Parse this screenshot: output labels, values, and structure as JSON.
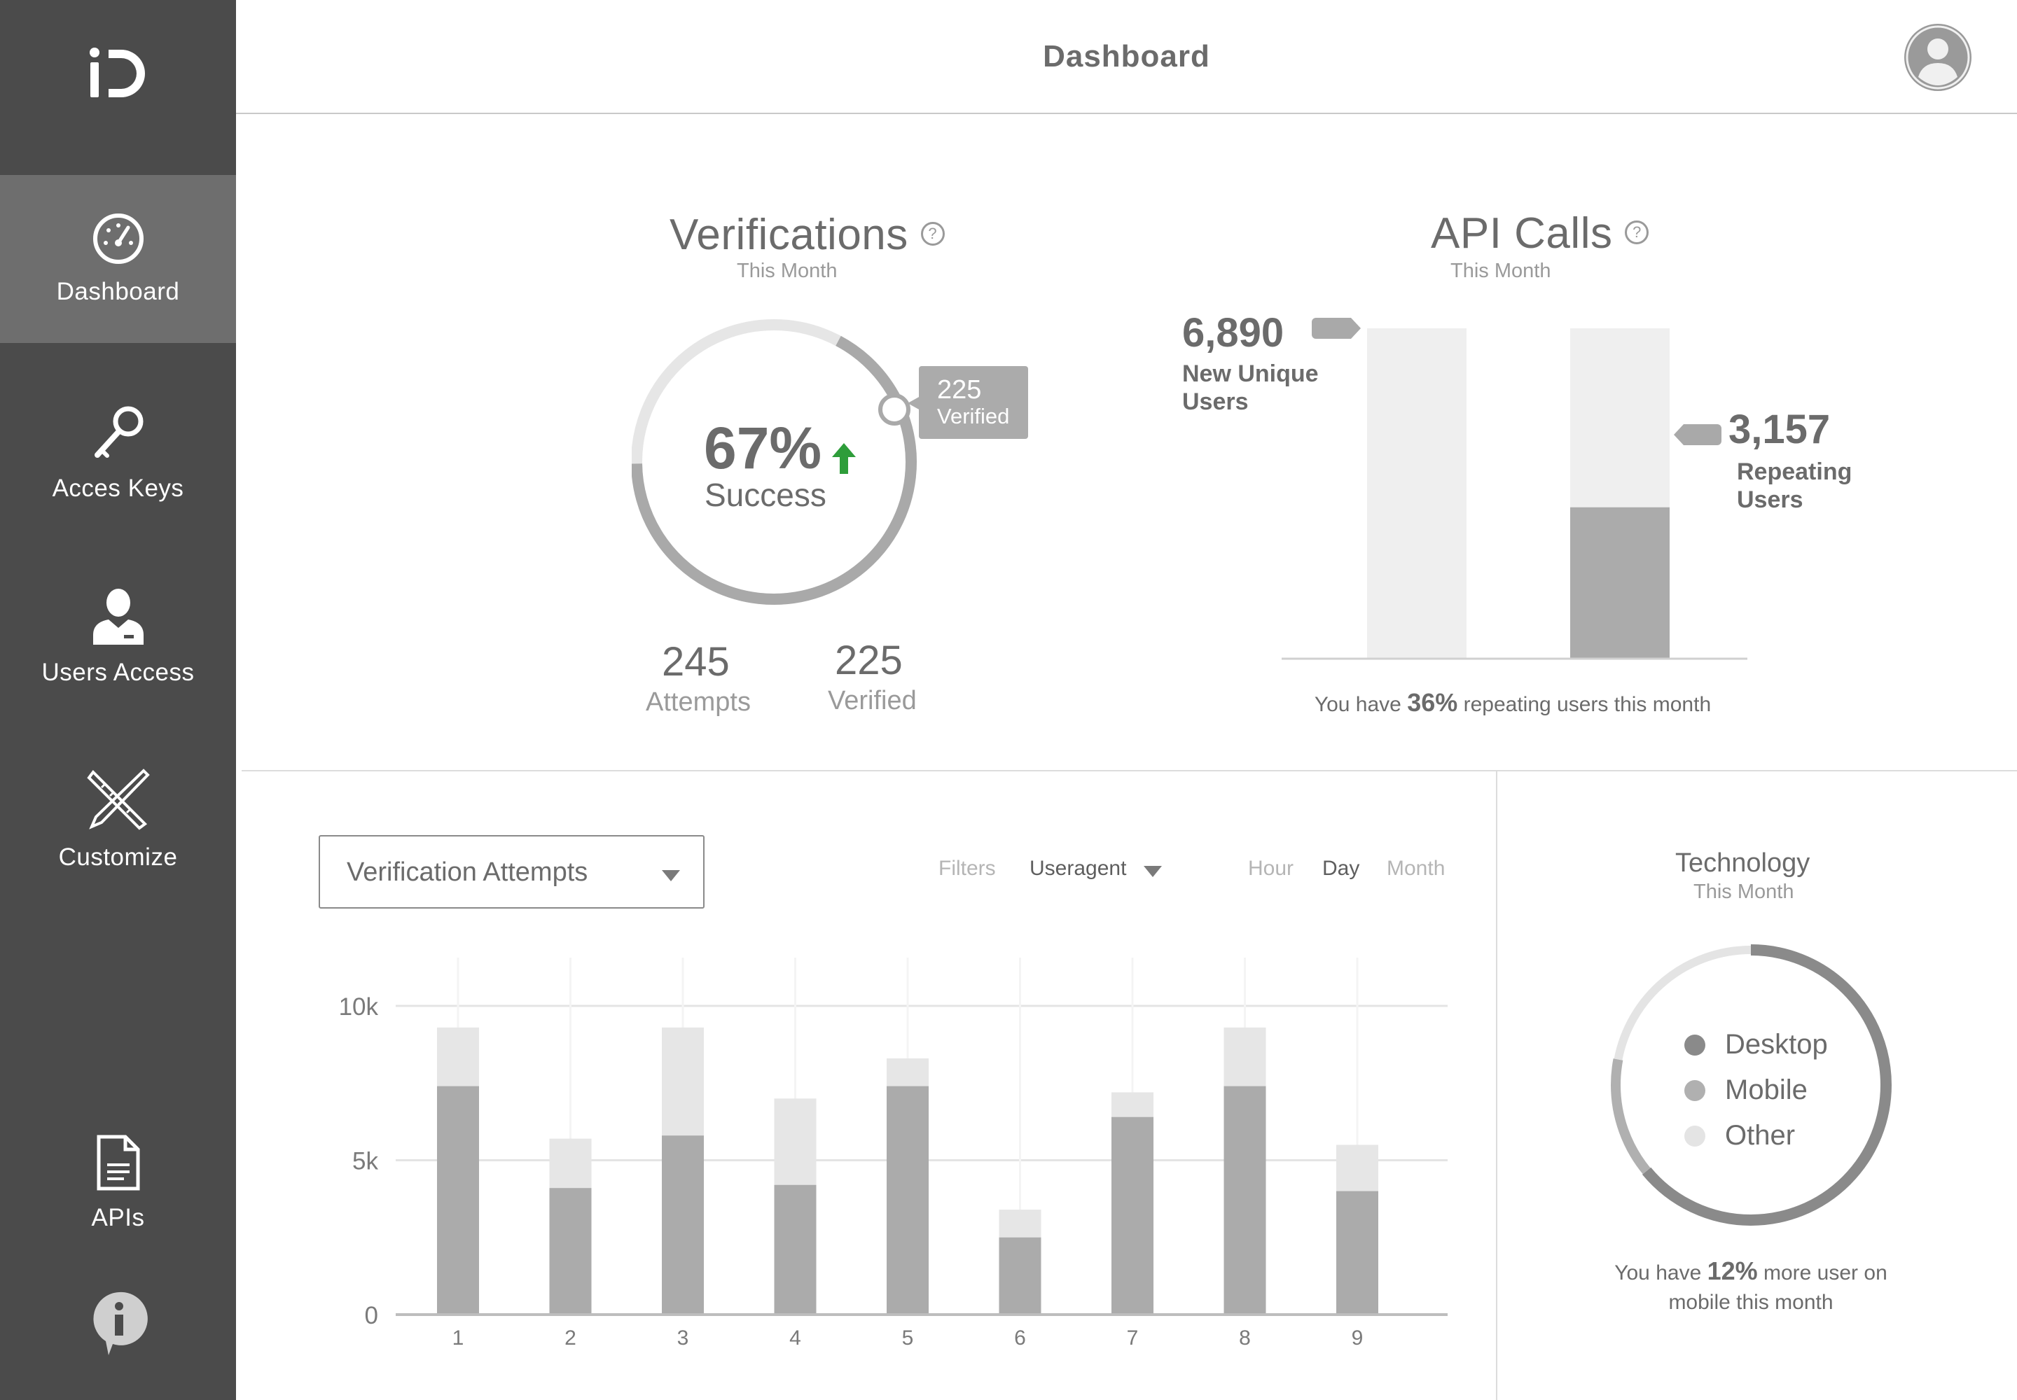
{
  "app": {
    "logo_text": "iD"
  },
  "header": {
    "title": "Dashboard"
  },
  "sidebar": {
    "items": [
      {
        "label": "Dashboard",
        "icon": "gauge-icon",
        "active": true
      },
      {
        "label": "Acces Keys",
        "icon": "key-icon"
      },
      {
        "label": "Users Access",
        "icon": "user-icon"
      },
      {
        "label": "Customize",
        "icon": "tools-icon"
      },
      {
        "label": "APIs",
        "icon": "document-icon"
      }
    ],
    "info_icon": "info-icon"
  },
  "verifications": {
    "title": "Verifications",
    "subtitle": "This Month",
    "help": "?",
    "percent_label": "67%",
    "percent_value": 0.67,
    "success_label": "Success",
    "tooltip_value": "225",
    "tooltip_label": "Verified",
    "attempts_value": "245",
    "attempts_label": "Attempts",
    "verified_value": "225",
    "verified_label": "Verified",
    "trend_color": "#2e9d3a"
  },
  "api_calls": {
    "title": "API Calls",
    "subtitle": "This Month",
    "help": "?",
    "new_users_value": "6,890",
    "new_users_label_1": "New Unique",
    "new_users_label_2": "Users",
    "repeat_users_value": "3,157",
    "repeat_users_label_1": "Repeating",
    "repeat_users_label_2": "Users",
    "footer_prefix": "You have",
    "footer_pct": "36%",
    "footer_suffix": "repeating users this month"
  },
  "attempts": {
    "select_value": "Verification Attempts",
    "filters_label": "Filters",
    "useragent_label": "Useragent",
    "range": {
      "hour": "Hour",
      "day": "Day",
      "month": "Month",
      "selected": "Day"
    }
  },
  "technology": {
    "title": "Technology",
    "subtitle": "This Month",
    "legend": [
      {
        "label": "Desktop",
        "color": "#8a8a8a"
      },
      {
        "label": "Mobile",
        "color": "#b0b0b0"
      },
      {
        "label": "Other",
        "color": "#e4e4e4"
      }
    ],
    "footer_prefix": "You have",
    "footer_pct": "12%",
    "footer_suffix_1": "more user on",
    "footer_suffix_2": "mobile this month"
  },
  "chart_data": [
    {
      "type": "bar",
      "title": "API Calls",
      "categories": [
        "New Unique Users",
        "Repeating Users"
      ],
      "series": [
        {
          "name": "New Unique Users",
          "values": [
            6890,
            6890
          ]
        },
        {
          "name": "Repeating Users",
          "values": [
            0,
            3157
          ]
        }
      ],
      "ylim": [
        0,
        6890
      ]
    },
    {
      "type": "bar",
      "title": "Verification Attempts",
      "categories": [
        "1",
        "2",
        "3",
        "4",
        "5",
        "6",
        "7",
        "8",
        "9"
      ],
      "yticks": [
        "0",
        "5k",
        "10k"
      ],
      "ylim": [
        0,
        10000
      ],
      "series": [
        {
          "name": "Verified",
          "values": [
            7400,
            4100,
            5800,
            4200,
            7400,
            2500,
            6400,
            7400,
            4000
          ]
        },
        {
          "name": "Attempts",
          "values": [
            9300,
            5700,
            9300,
            7000,
            8300,
            3400,
            7200,
            9300,
            5500
          ]
        }
      ],
      "grid": true
    },
    {
      "type": "pie",
      "title": "Technology",
      "categories": [
        "Desktop",
        "Mobile",
        "Other"
      ],
      "values": [
        64,
        14,
        22
      ]
    }
  ]
}
